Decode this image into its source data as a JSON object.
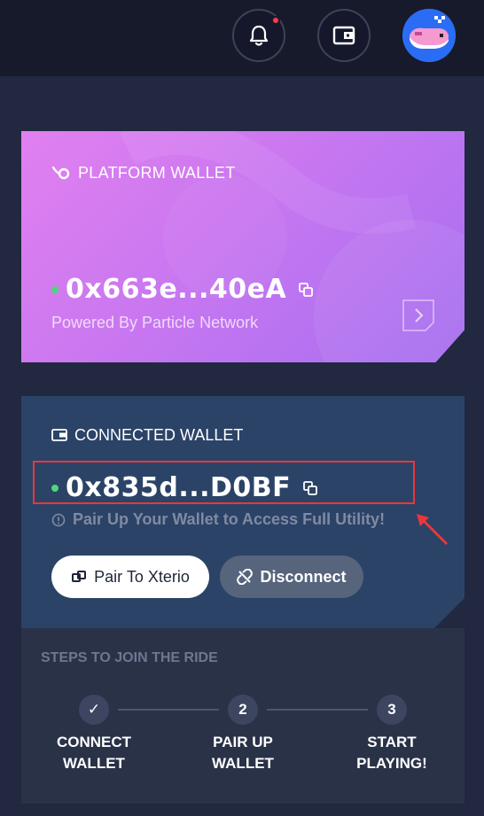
{
  "header": {
    "notification_icon": "bell-icon",
    "wallet_icon": "wallet-icon",
    "avatar_icon": "whale-avatar"
  },
  "platform_wallet": {
    "label": "PLATFORM WALLET",
    "address": "0x663e...40eA",
    "powered_by": "Powered By Particle Network"
  },
  "connected_wallet": {
    "label": "CONNECTED WALLET",
    "address": "0x835d...D0BF",
    "hint": "Pair Up Your Wallet to Access Full Utility!",
    "pair_button": "Pair To Xterio",
    "disconnect_button": "Disconnect"
  },
  "steps": {
    "title": "STEPS TO JOIN THE RIDE",
    "items": [
      {
        "marker": "✓",
        "line1": "CONNECT",
        "line2": "WALLET"
      },
      {
        "marker": "2",
        "line1": "PAIR UP",
        "line2": "WALLET"
      },
      {
        "marker": "3",
        "line1": "START",
        "line2": "PLAYING!"
      }
    ]
  },
  "colors": {
    "background": "#1e2236",
    "platform_gradient_start": "#e180f0",
    "platform_gradient_end": "#a56ef0",
    "connected_card": "#2b4367",
    "status_green": "#4fd67d",
    "highlight_red": "#e9373c"
  }
}
